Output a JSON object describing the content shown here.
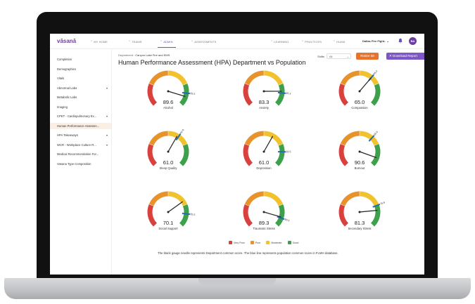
{
  "app": {
    "logo": "vāsanā"
  },
  "nav": [
    {
      "label": "MY HOME",
      "icon": "home-icon",
      "active": false
    },
    {
      "label": "TEAMS",
      "icon": "teams-icon",
      "active": false
    },
    {
      "label": "ADMIN",
      "icon": "user-icon",
      "active": true
    },
    {
      "label": "ASSESSMENTS",
      "icon": "clipboard-icon",
      "active": false
    },
    {
      "label": "LEARNING",
      "icon": "learning-icon",
      "active": false
    },
    {
      "label": "PRACTICES",
      "icon": "practices-icon",
      "active": false
    },
    {
      "label": "HUMA",
      "icon": "huma-icon",
      "active": false
    }
  ],
  "org": {
    "label": "Dallas Fire Fight..",
    "caret": "⌄"
  },
  "user": {
    "initials": "BA"
  },
  "sidebar": [
    {
      "label": "Completion",
      "caret": ""
    },
    {
      "label": "Demographics",
      "caret": ""
    },
    {
      "label": "Vitals",
      "caret": ""
    },
    {
      "label": "Abnormal Labs",
      "caret": "▾"
    },
    {
      "label": "Metabolic Labs",
      "caret": ""
    },
    {
      "label": "Imaging",
      "caret": ""
    },
    {
      "label": "CPET - Cardiopulmonary Ex...",
      "caret": "▾"
    },
    {
      "label": "Human Performance Assessm...",
      "caret": ""
    },
    {
      "label": "HPA Takeaways",
      "caret": "▾"
    },
    {
      "label": "WCR - Workplace Culture R...",
      "caret": "▾"
    },
    {
      "label": "Medical Recommendation For...",
      "caret": ""
    },
    {
      "label": "Vasana Type Composition",
      "caret": ""
    }
  ],
  "header": {
    "breadcrumb_prefix": "Department :",
    "breadcrumb_value": "Canyon Lake Fire and EMS",
    "title": "Human Performance Assessment (HPA) Department vs Population",
    "shifts_label": "Shifts",
    "shifts_value": "All",
    "roster_button": "Roster 58",
    "download_button": "Download Report"
  },
  "colors": {
    "very_poor": "#d9413e",
    "poor": "#e8922c",
    "moderate": "#f2c12e",
    "good": "#3da14c",
    "needle": "#222222",
    "population": "#1f6fae"
  },
  "gauges": [
    {
      "label": "Alcohol",
      "score": "89.6",
      "pop": "85.5"
    },
    {
      "label": "Anxiety",
      "score": "83.3",
      "pop": "85.3"
    },
    {
      "label": "Compassion",
      "score": "65.0",
      "pop": "65.0"
    },
    {
      "label": "Sleep Quality",
      "score": "61.0",
      "pop": "62.8"
    },
    {
      "label": "Depression",
      "score": "61.0",
      "pop": "83.5"
    },
    {
      "label": "Burnout",
      "score": "90.6",
      "pop": "65.5"
    },
    {
      "label": "Social Support",
      "score": "70.1",
      "pop": "85.5"
    },
    {
      "label": "Traumatic Stress",
      "score": "89.3",
      "pop": "90.5"
    },
    {
      "label": "Secondary Stress",
      "score": "81.3",
      "pop": "75.6"
    }
  ],
  "legend": [
    {
      "label": "Very Poor",
      "color": "#d9413e"
    },
    {
      "label": "Poor",
      "color": "#e8922c"
    },
    {
      "label": "Moderate",
      "color": "#f2c12e"
    },
    {
      "label": "Good",
      "color": "#3da14c"
    }
  ],
  "footnote": "The black gauge needle represents Department common score. The blue line represents population common score in FLMH database."
}
